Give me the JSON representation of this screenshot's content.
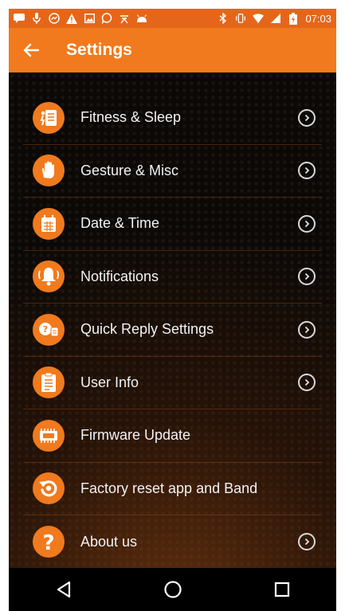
{
  "status_bar": {
    "time": "07:03",
    "left_icons": [
      "message-icon",
      "mic-icon",
      "messenger-icon",
      "warning-icon",
      "image-icon",
      "whatsapp-icon",
      "nosignal-icon",
      "android-icon"
    ],
    "right_icons": [
      "bluetooth-icon",
      "vibrate-icon",
      "wifi-icon",
      "cell-signal-icon",
      "battery-icon"
    ]
  },
  "app_bar": {
    "title": "Settings"
  },
  "menu": {
    "items": [
      {
        "label": "Fitness & Sleep",
        "icon": "fitness-icon",
        "chevron": true
      },
      {
        "label": "Gesture & Misc",
        "icon": "gesture-icon",
        "chevron": true
      },
      {
        "label": "Date & Time",
        "icon": "calendar-icon",
        "chevron": true
      },
      {
        "label": "Notifications",
        "icon": "bell-icon",
        "chevron": true
      },
      {
        "label": "Quick Reply Settings",
        "icon": "quick-reply-icon",
        "chevron": true
      },
      {
        "label": "User Info",
        "icon": "clipboard-icon",
        "chevron": true
      },
      {
        "label": "Firmware Update",
        "icon": "chip-icon",
        "chevron": false
      },
      {
        "label": "Factory reset app and Band",
        "icon": "reset-icon",
        "chevron": false
      },
      {
        "label": "About us",
        "icon": "question-icon",
        "chevron": true
      }
    ]
  },
  "nav_bar": {
    "buttons": [
      "back-icon",
      "home-icon",
      "recents-icon"
    ]
  },
  "colors": {
    "accent": "#f07a1d",
    "status_bar": "#e5661a",
    "background": "#000000"
  }
}
